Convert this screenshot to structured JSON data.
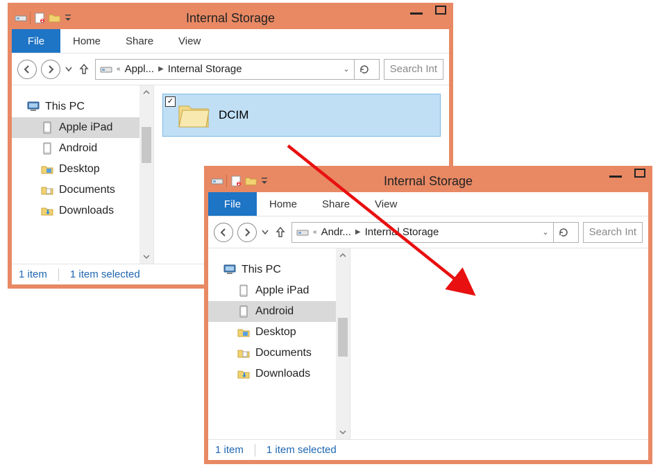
{
  "window1": {
    "title": "Internal Storage",
    "tabs": {
      "file": "File",
      "home": "Home",
      "share": "Share",
      "view": "View"
    },
    "breadcrumb": {
      "crumb1": "Appl...",
      "crumb2": "Internal Storage"
    },
    "search_placeholder": "Search Int",
    "sidebar": {
      "root": "This PC",
      "items": [
        "Apple iPad",
        "Android",
        "Desktop",
        "Documents",
        "Downloads"
      ],
      "selected_index": 0
    },
    "content": {
      "folder_name": "DCIM",
      "checked": "✓"
    },
    "status": {
      "count": "1 item",
      "selection": "1 item selected"
    }
  },
  "window2": {
    "title": "Internal Storage",
    "tabs": {
      "file": "File",
      "home": "Home",
      "share": "Share",
      "view": "View"
    },
    "breadcrumb": {
      "crumb1": "Andr...",
      "crumb2": "Internal Storage"
    },
    "search_placeholder": "Search Int",
    "sidebar": {
      "root": "This PC",
      "items": [
        "Apple iPad",
        "Android",
        "Desktop",
        "Documents",
        "Downloads"
      ],
      "selected_index": 1
    },
    "status": {
      "count": "1 item",
      "selection": "1 item selected"
    }
  }
}
